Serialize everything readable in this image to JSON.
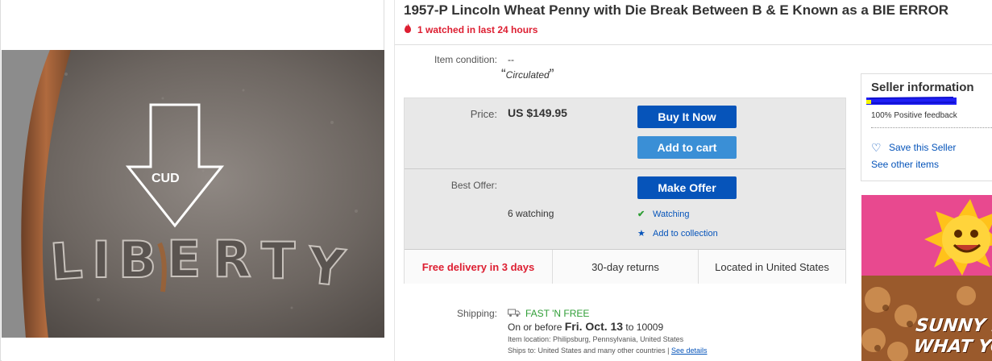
{
  "listing": {
    "title": "1957-P Lincoln Wheat Penny with Die Break Between B & E Known as a BIE ERROR",
    "watched_text": "1 watched in last 24 hours"
  },
  "image": {
    "coin_text": "LIBERTY",
    "arrow_label": "CUD"
  },
  "condition": {
    "label": "Item condition:",
    "value": "--",
    "note": "Circulated",
    "open_quote": "“",
    "close_quote": "”"
  },
  "price": {
    "label": "Price:",
    "value": "US $149.95",
    "buy_now_label": "Buy It Now",
    "add_to_cart_label": "Add to cart"
  },
  "offer": {
    "label": "Best Offer:",
    "make_offer_label": "Make Offer",
    "watching_count": "6 watching",
    "watching_link": "Watching",
    "add_collection_link": "Add to collection"
  },
  "highlights": {
    "delivery": "Free delivery in 3 days",
    "returns": "30-day returns",
    "location": "Located in United States"
  },
  "shipping": {
    "label": "Shipping:",
    "fast_free": "FAST 'N FREE",
    "on_or_before": "On or before",
    "date": "Fri. Oct. 13",
    "to_text": "to 10009",
    "item_location": "Item location:  Philipsburg, Pennsylvania, United States",
    "ships_to": "Ships to:  United States and many other countries |",
    "see_details": "See details"
  },
  "seller": {
    "title": "Seller information",
    "feedback": "100% Positive feedback",
    "save_seller": "Save this Seller",
    "other_items": "See other items"
  },
  "ad": {
    "line1": "SUNNY KI",
    "line2": "WHAT YO"
  },
  "colors": {
    "accent_blue": "#0654ba",
    "alert_red": "#dd1e31",
    "success_green": "#2f9e36"
  }
}
